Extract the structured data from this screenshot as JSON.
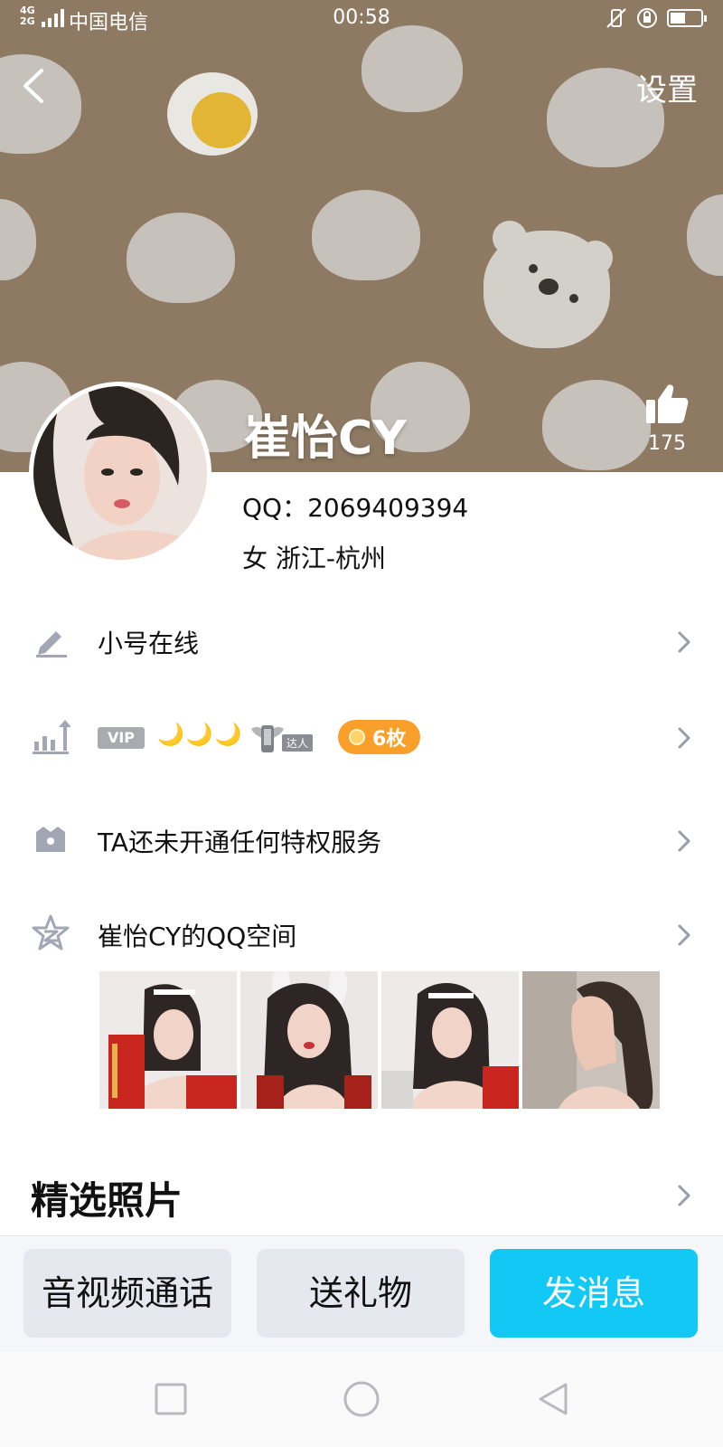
{
  "status_bar": {
    "network_top": "4G",
    "network_bottom": "2G",
    "carrier": "中国电信",
    "time": "00:58"
  },
  "header": {
    "settings_label": "设置",
    "back_icon": "chevron-left-icon"
  },
  "profile": {
    "name": "崔怡CY",
    "likes": "175",
    "qq": "QQ：2069409394",
    "location": "女  浙江-杭州"
  },
  "rows": {
    "status_label": "小号在线",
    "vip_badge": "VIP",
    "moons": "🌙🌙🌙",
    "daren_label": "达人",
    "medal_count": "6枚",
    "privilege_label": "TA还未开通任何特权服务",
    "qzone_label": "崔怡CY的QQ空间"
  },
  "featured": {
    "title": "精选照片"
  },
  "actions": {
    "call_label": "音视频通话",
    "gift_label": "送礼物",
    "message_label": "发消息"
  },
  "colors": {
    "cover_bg": "#8e7a63",
    "primary_button": "#12c9f5",
    "medal_pill": "#fb9f2b",
    "icon_gray": "#a3a7b5"
  }
}
